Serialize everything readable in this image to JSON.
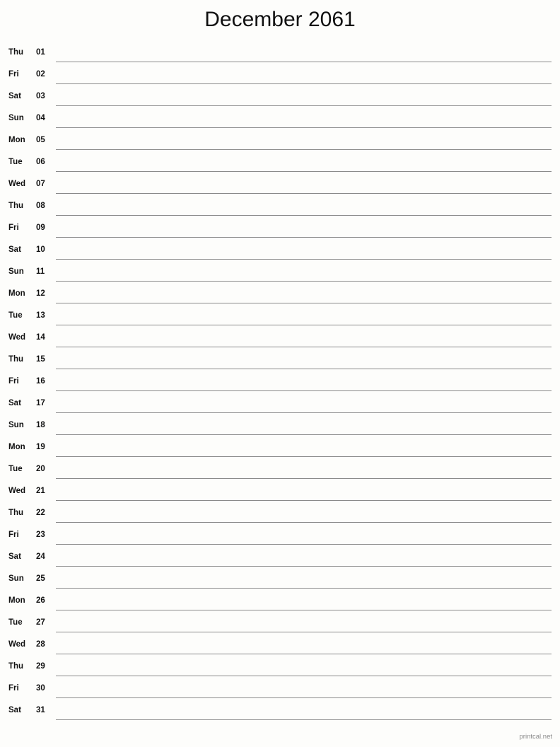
{
  "page": {
    "title": "December 2061",
    "background_color": "#fdfdfb",
    "text_color": "#111111",
    "rule_color": "#8a8a8a"
  },
  "footer": {
    "credit": "printcal.net",
    "color": "#8a8a8a"
  },
  "calendar": {
    "month": "December",
    "year": "2061",
    "days": [
      {
        "weekday": "Thu",
        "number": "01"
      },
      {
        "weekday": "Fri",
        "number": "02"
      },
      {
        "weekday": "Sat",
        "number": "03"
      },
      {
        "weekday": "Sun",
        "number": "04"
      },
      {
        "weekday": "Mon",
        "number": "05"
      },
      {
        "weekday": "Tue",
        "number": "06"
      },
      {
        "weekday": "Wed",
        "number": "07"
      },
      {
        "weekday": "Thu",
        "number": "08"
      },
      {
        "weekday": "Fri",
        "number": "09"
      },
      {
        "weekday": "Sat",
        "number": "10"
      },
      {
        "weekday": "Sun",
        "number": "11"
      },
      {
        "weekday": "Mon",
        "number": "12"
      },
      {
        "weekday": "Tue",
        "number": "13"
      },
      {
        "weekday": "Wed",
        "number": "14"
      },
      {
        "weekday": "Thu",
        "number": "15"
      },
      {
        "weekday": "Fri",
        "number": "16"
      },
      {
        "weekday": "Sat",
        "number": "17"
      },
      {
        "weekday": "Sun",
        "number": "18"
      },
      {
        "weekday": "Mon",
        "number": "19"
      },
      {
        "weekday": "Tue",
        "number": "20"
      },
      {
        "weekday": "Wed",
        "number": "21"
      },
      {
        "weekday": "Thu",
        "number": "22"
      },
      {
        "weekday": "Fri",
        "number": "23"
      },
      {
        "weekday": "Sat",
        "number": "24"
      },
      {
        "weekday": "Sun",
        "number": "25"
      },
      {
        "weekday": "Mon",
        "number": "26"
      },
      {
        "weekday": "Tue",
        "number": "27"
      },
      {
        "weekday": "Wed",
        "number": "28"
      },
      {
        "weekday": "Thu",
        "number": "29"
      },
      {
        "weekday": "Fri",
        "number": "30"
      },
      {
        "weekday": "Sat",
        "number": "31"
      }
    ]
  }
}
